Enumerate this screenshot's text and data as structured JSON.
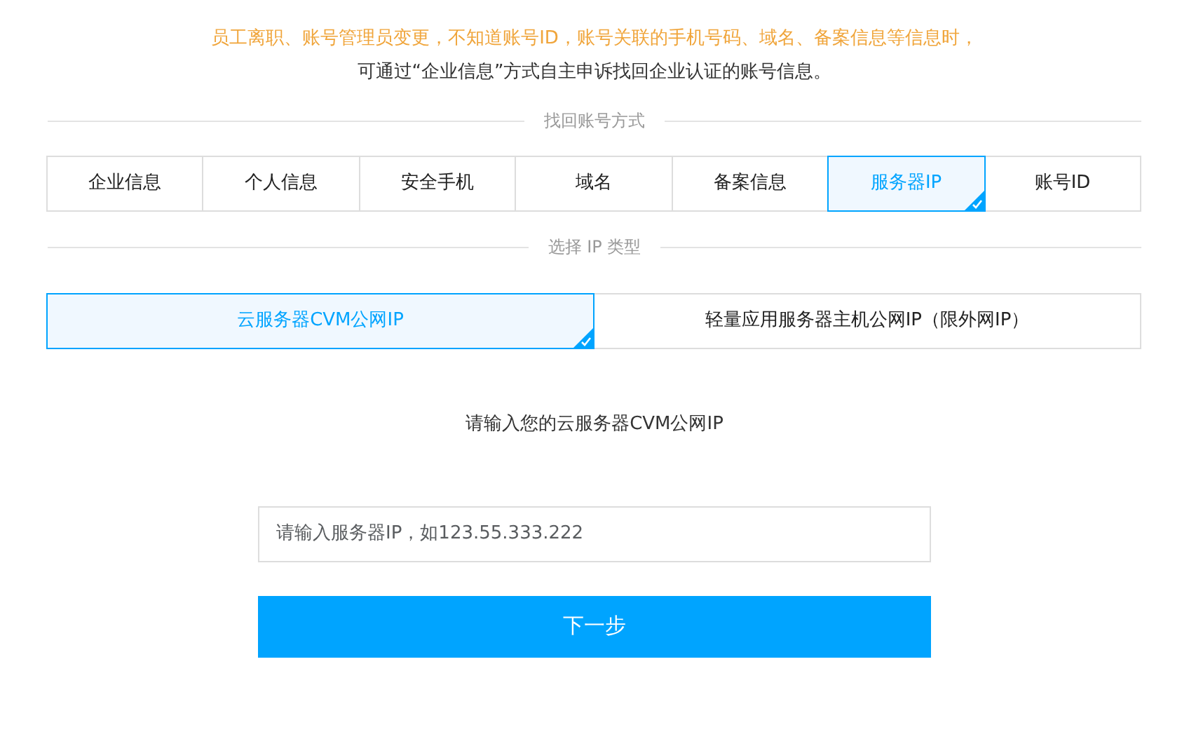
{
  "notice": {
    "warning": "员工离职、账号管理员变更，不知道账号ID，账号关联的手机号码、域名、备案信息等信息时，",
    "hint": "可通过“企业信息”方式自主申诉找回企业认证的账号信息。"
  },
  "method_divider": "找回账号方式",
  "methods": [
    {
      "label": "企业信息",
      "selected": false
    },
    {
      "label": "个人信息",
      "selected": false
    },
    {
      "label": "安全手机",
      "selected": false
    },
    {
      "label": "域名",
      "selected": false
    },
    {
      "label": "备案信息",
      "selected": false
    },
    {
      "label": "服务器IP",
      "selected": true
    },
    {
      "label": "账号ID",
      "selected": false
    }
  ],
  "ip_type_divider": "选择 IP 类型",
  "ip_types": [
    {
      "label": "云服务器CVM公网IP",
      "selected": true
    },
    {
      "label": "轻量应用服务器主机公网IP（限外网IP）",
      "selected": false
    }
  ],
  "prompt": "请输入您的云服务器CVM公网IP",
  "ip_field": {
    "placeholder": "请输入服务器IP，如123.55.333.222"
  },
  "next_button": "下一步"
}
